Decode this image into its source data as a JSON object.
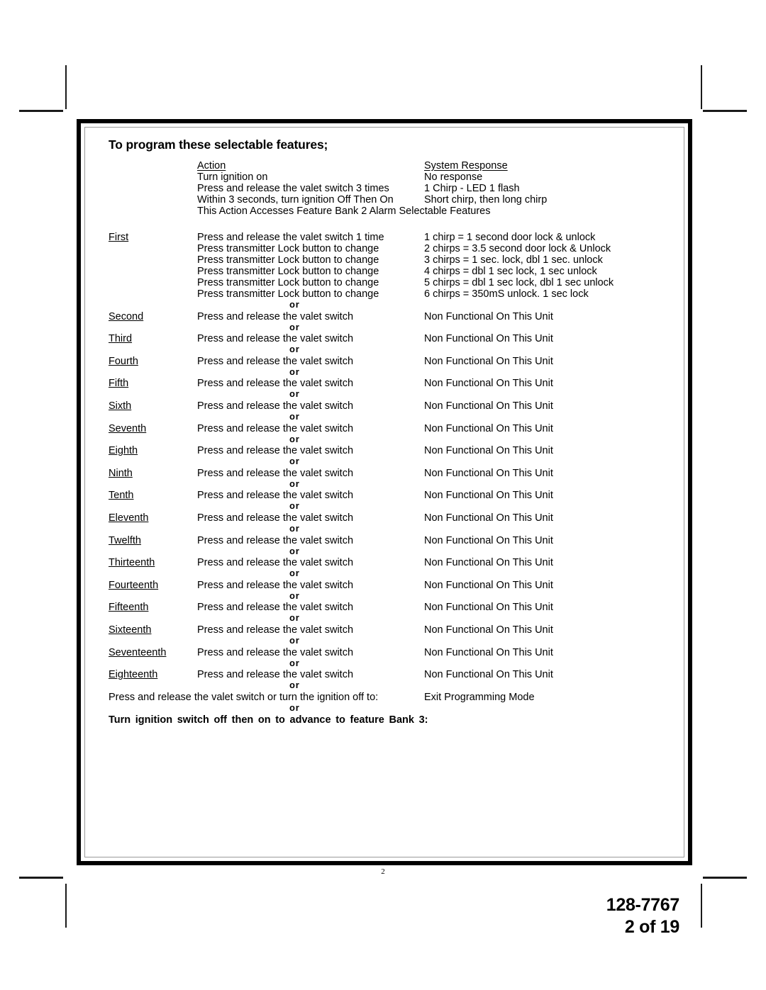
{
  "document": {
    "title": "To program these selectable features;",
    "page_number": "2"
  },
  "table": {
    "headers": {
      "action": "Action",
      "response": "System Response"
    },
    "entry_sequence": [
      {
        "action": "Turn ignition on",
        "response": "No response"
      },
      {
        "action": "Press and release the valet switch 3 times",
        "response": "1 Chirp - LED 1 flash"
      },
      {
        "action": "Within 3 seconds, turn ignition Off Then On",
        "response": "Short chirp, then long chirp"
      }
    ],
    "access_note": "This Action Accesses Feature Bank 2 Alarm Selectable Features",
    "separator": "or",
    "first_feature": {
      "ordinal": "First",
      "lines": [
        {
          "action": "Press and release the valet switch 1 time",
          "response": "1 chirp = 1 second door lock & unlock"
        },
        {
          "action": "Press transmitter Lock button to change",
          "response": "2 chirps = 3.5 second door lock & Unlock"
        },
        {
          "action": "Press transmitter Lock button to change",
          "response": "3 chirps = 1 sec. lock, dbl 1 sec. unlock"
        },
        {
          "action": "Press transmitter Lock button to change",
          "response": "4 chirps = dbl 1 sec lock, 1 sec unlock"
        },
        {
          "action": "Press transmitter Lock button to change",
          "response": "5 chirps = dbl 1 sec lock, dbl 1 sec unlock"
        },
        {
          "action": "Press transmitter Lock button to change",
          "response": "6 chirps = 350mS unlock. 1 sec lock"
        }
      ]
    },
    "features": [
      {
        "ordinal": "Second",
        "action": "Press and release the valet switch",
        "response": "Non Functional On This Unit"
      },
      {
        "ordinal": "Third",
        "action": "Press and release the valet switch",
        "response": "Non Functional On This Unit"
      },
      {
        "ordinal": "Fourth",
        "action": "Press and release the valet switch",
        "response": "Non Functional On This Unit"
      },
      {
        "ordinal": "Fifth",
        "action": "Press and release the valet switch",
        "response": "Non Functional On This Unit"
      },
      {
        "ordinal": "Sixth",
        "action": "Press and release the valet switch",
        "response": "Non Functional On This Unit"
      },
      {
        "ordinal": "Seventh",
        "action": "Press and release the valet switch",
        "response": "Non Functional On This Unit"
      },
      {
        "ordinal": "Eighth",
        "action": "Press and release the valet switch",
        "response": "Non Functional On This Unit"
      },
      {
        "ordinal": "Ninth",
        "action": "Press and release the valet switch",
        "response": "Non Functional On This Unit"
      },
      {
        "ordinal": "Tenth",
        "action": "Press and release the valet switch",
        "response": "Non Functional On This Unit"
      },
      {
        "ordinal": "Eleventh",
        "action": "Press and release the valet switch",
        "response": "Non Functional On This Unit"
      },
      {
        "ordinal": "Twelfth",
        "action": "Press and release the valet switch",
        "response": "Non Functional On This Unit"
      },
      {
        "ordinal": "Thirteenth",
        "action": "Press and release the valet switch",
        "response": "Non Functional On This Unit"
      },
      {
        "ordinal": "Fourteenth",
        "action": "Press and release the valet switch",
        "response": "Non Functional On This Unit"
      },
      {
        "ordinal": "Fifteenth",
        "action": "Press and release the valet switch",
        "response": "Non Functional On This Unit"
      },
      {
        "ordinal": "Sixteenth",
        "action": "Press and release the valet switch",
        "response": "Non Functional On This Unit"
      },
      {
        "ordinal": "Seventeenth",
        "action": "Press and release the valet switch",
        "response": "Non Functional On This Unit"
      },
      {
        "ordinal": "Eighteenth",
        "action": "Press and release the valet switch",
        "response": "Non Functional On This Unit"
      }
    ],
    "exit_row": {
      "action": "Press and release the valet switch or turn the ignition off to:",
      "response": "Exit Programming Mode"
    },
    "closing_bold": "Turn ignition switch off then on to advance to feature Bank 3:"
  },
  "footer": {
    "part_number": "128-7767",
    "page_of": "2 of 19"
  }
}
